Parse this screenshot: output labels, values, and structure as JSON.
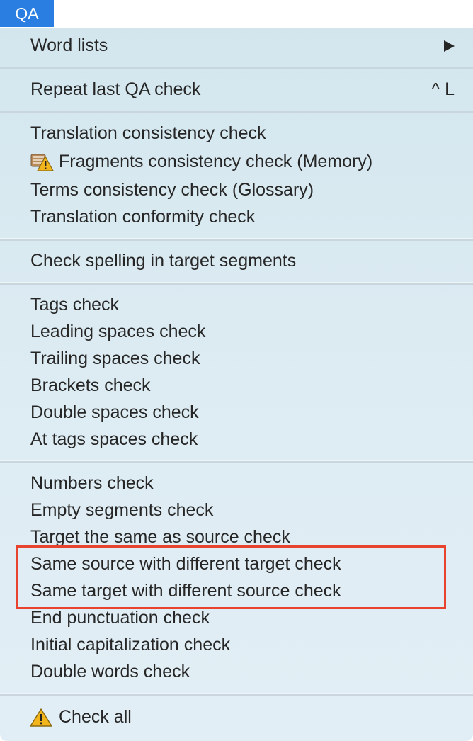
{
  "menu": {
    "title": "QA"
  },
  "items": {
    "word_lists": "Word lists",
    "repeat_last": "Repeat last QA check",
    "repeat_last_shortcut": "^ L",
    "translation_consistency": "Translation consistency check",
    "fragments_consistency": "Fragments consistency check (Memory)",
    "terms_consistency": "Terms consistency check (Glossary)",
    "translation_conformity": "Translation conformity check",
    "check_spelling": "Check spelling in target segments",
    "tags_check": "Tags check",
    "leading_spaces": "Leading spaces check",
    "trailing_spaces": "Trailing spaces check",
    "brackets": "Brackets check",
    "double_spaces": "Double spaces check",
    "at_tags_spaces": "At tags spaces check",
    "numbers": "Numbers check",
    "empty_segments": "Empty segments check",
    "target_same_as_source": "Target the same as source check",
    "same_source_diff_target": "Same source with different target check",
    "same_target_diff_source": "Same target with different source check",
    "end_punctuation": "End punctuation check",
    "initial_capitalization": "Initial capitalization check",
    "double_words": "Double words check",
    "check_all": "Check all"
  },
  "icons": {
    "submenu": "submenu-arrow-icon",
    "fragments": "memory-warning-icon",
    "check_all": "warning-icon"
  },
  "colors": {
    "menu_title_bg": "#2a7de1",
    "highlight_border": "#e8432f",
    "warning_fill": "#f3b51c"
  }
}
